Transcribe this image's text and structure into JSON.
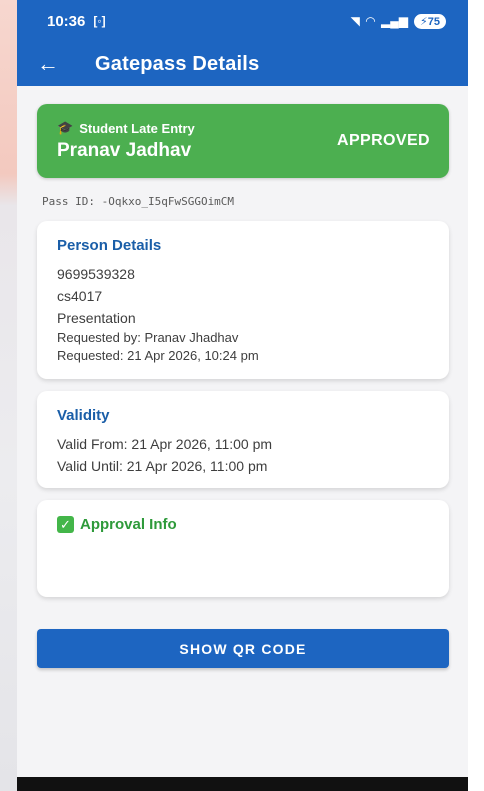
{
  "status_bar": {
    "time": "10:36",
    "left_icon": "screen-record-icon",
    "right_icons": [
      "mute-icon",
      "wifi-icon",
      "signal-icon"
    ],
    "battery": "75"
  },
  "app_bar": {
    "back_icon": "arrow-left-icon",
    "title": "Gatepass Details"
  },
  "status_card": {
    "type_icon": "graduation-cap-icon",
    "type": "Student Late Entry",
    "name": "Pranav Jadhav",
    "status": "APPROVED",
    "color": "#4caf50"
  },
  "pass_id": "Pass ID: -Oqkxo_I5qFwSGGOimCM",
  "person_details": {
    "title": "Person Details",
    "phone": "9699539328",
    "id": "cs4017",
    "reason": "Presentation",
    "requested_by": "Requested by: Pranav Jhadhav",
    "requested_at": "Requested: 21 Apr 2026, 10:24 pm"
  },
  "validity": {
    "title": "Validity",
    "valid_from": "Valid From: 21 Apr 2026, 11:00 pm",
    "valid_until": "Valid Until: 21 Apr 2026, 11:00 pm"
  },
  "approval_info": {
    "icon": "check-box-icon",
    "title": "Approval Info"
  },
  "qr_button": {
    "label": "SHOW QR CODE"
  },
  "colors": {
    "primary": "#1d65c1",
    "approved": "#4caf50",
    "section_title": "#1a5ea8",
    "approval_title": "#2e9a3a"
  }
}
